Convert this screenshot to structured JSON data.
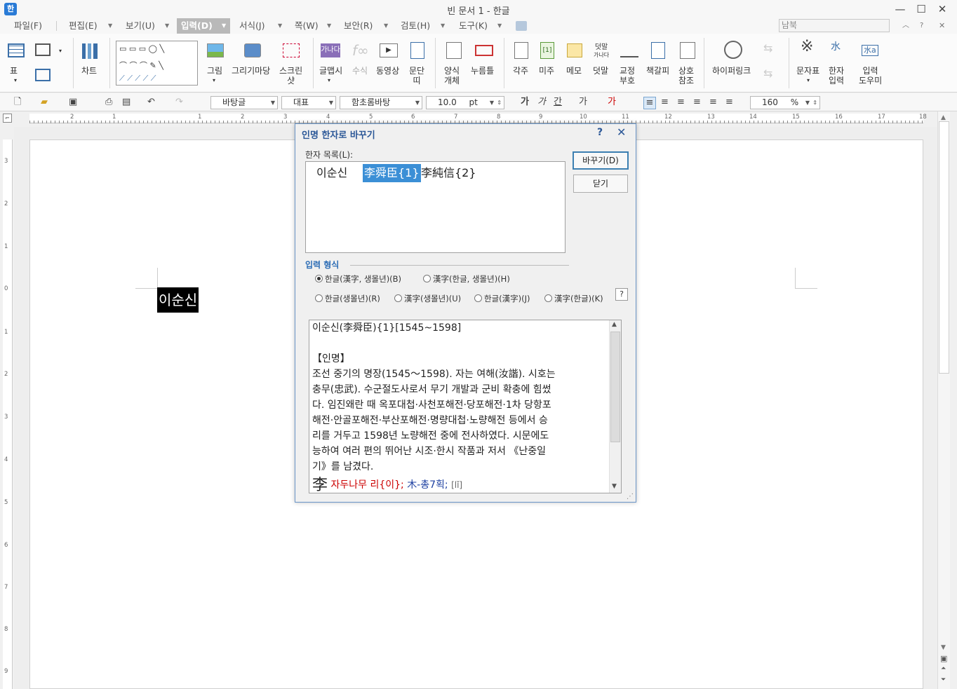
{
  "window": {
    "title": "빈 문서 1 - 한글",
    "app_icon": "한"
  },
  "menu": {
    "items": [
      "파일(F)",
      "편집(E)",
      "보기(U)",
      "입력(D)",
      "서식(J)",
      "쪽(W)",
      "보안(R)",
      "검토(H)",
      "도구(K)"
    ],
    "active_index": 3,
    "search_placeholder": "남북"
  },
  "ribbon": {
    "table": "표",
    "chart": "차트",
    "picture": "그림",
    "drawing": "그리기마당",
    "screenshot": "스크린\n샷",
    "glyph_art": "글맵시",
    "equation": "수식",
    "video": "동영상",
    "column_border": "문단\n띠",
    "form_object": "양식\n개체",
    "push_button": "누름틀",
    "footnote": "각주",
    "endnote": "미주",
    "memo": "메모",
    "overwrite": "덧말",
    "proofread": "교정\n부호",
    "bookmark": "책갈피",
    "cross_ref": "상호\n참조",
    "hyperlink": "하이퍼링크",
    "symbols": "문자표",
    "hanja_input": "한자\n입력",
    "input_helper": "입력\n도우미",
    "overwrite_icon_text": "덧말",
    "overwrite_icon_sub": "가나다",
    "hanja_icon_text": "水",
    "helper_icon_text": "水a"
  },
  "format_bar": {
    "style": "바탕글",
    "lang": "대표",
    "font": "함초롬바탕",
    "size": "10.0",
    "size_unit": "pt",
    "zoom": "160",
    "zoom_unit": "%"
  },
  "ruler": {
    "h_marks": [
      "2",
      "1",
      "1",
      "2",
      "3",
      "4",
      "5",
      "6",
      "7",
      "8",
      "9",
      "10",
      "11",
      "12",
      "13",
      "14",
      "15",
      "16",
      "17",
      "18"
    ],
    "v_marks": [
      "3",
      "2",
      "1",
      "0",
      "1",
      "2",
      "3",
      "4",
      "5",
      "6",
      "7",
      "8",
      "9"
    ]
  },
  "document": {
    "selected_text": "이순신"
  },
  "dialog": {
    "title": "인명 한자로 바꾸기",
    "help": "?",
    "close": "✕",
    "list_label": "한자 목록(L):",
    "list_items": [
      "이순신",
      "李舜臣{1}",
      "李純信{2}"
    ],
    "selected_index": 1,
    "replace_button": "바꾸기(D)",
    "close_button": "닫기",
    "format_label": "입력 형식",
    "format_help": "?",
    "formats": [
      "한글(漢字, 생몰년)(B)",
      "漢字(한글, 생몰년)(H)",
      "한글(생몰년)(R)",
      "漢字(생몰년)(U)",
      "한글(漢字)(J)",
      "漢字(한글)(K)"
    ],
    "format_selected": 0,
    "desc_head": "이순신(李舜臣){1}[1545~1598]",
    "desc_section": "【인명】",
    "desc_lines": [
      "조선 중기의 명장(1545～1598). 자는 여해(汝諧). 시호는",
      "충무(忠武). 수군절도사로서 무기 개발과 군비 확충에 힘썼",
      "다. 임진왜란 때 옥포대첩·사천포해전·당포해전·1차 당항포",
      "해전·안골포해전·부산포해전·명량대첩·노량해전 등에서 승",
      "리를 거두고 1598년 노량해전 중에 전사하였다. 시문에도",
      "능하여 여러 편의 뛰어난 시조·한시 작품과 저서 《난중일",
      "기》를 남겼다."
    ],
    "desc_char": "李",
    "desc_char_reading": "자두나무 리{이};",
    "desc_char_radical": "木-총7획;",
    "desc_char_pron": "[lǐ]"
  }
}
